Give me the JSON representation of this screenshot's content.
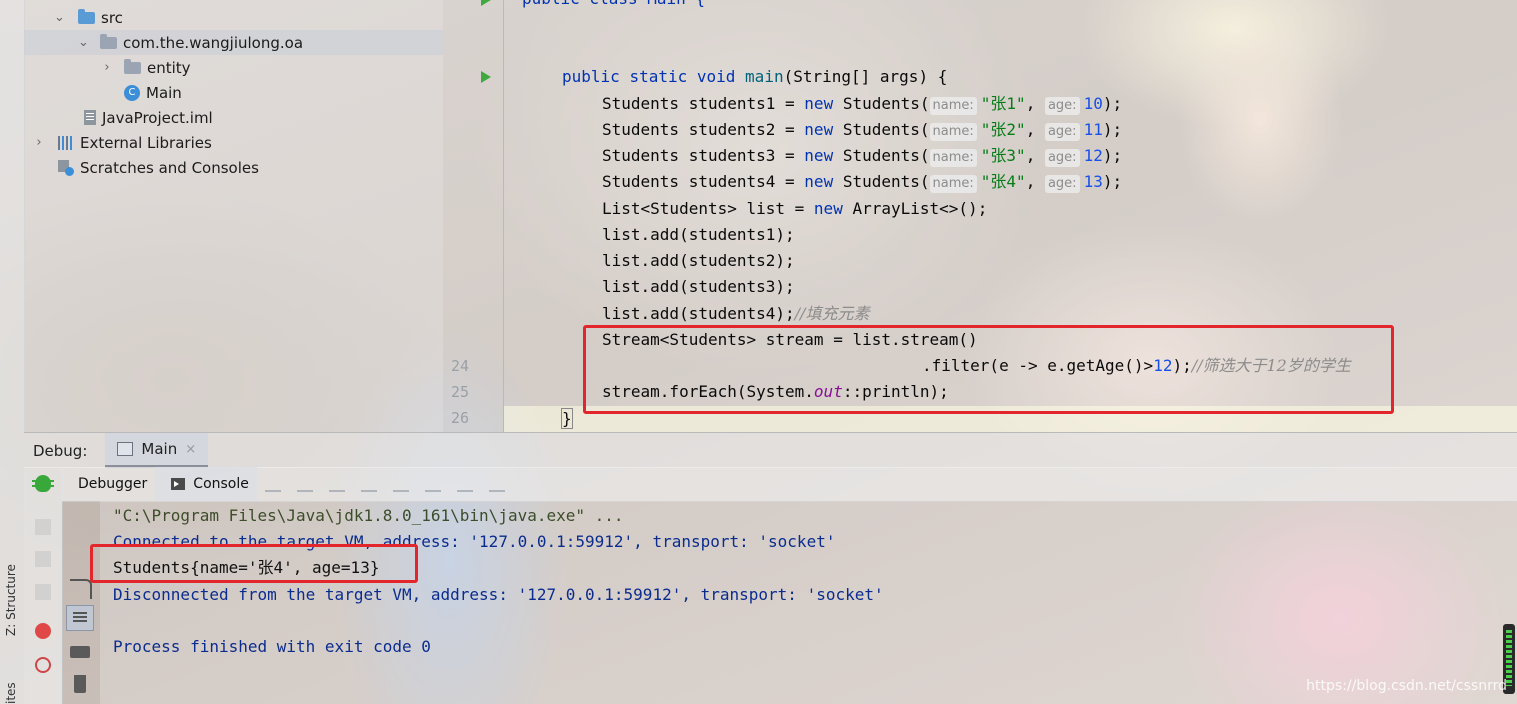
{
  "project_tree": {
    "items": [
      {
        "label": "src",
        "icon": "folder-icon"
      },
      {
        "label": "com.the.wangjiulong.oa",
        "icon": "package-icon"
      },
      {
        "label": "entity",
        "icon": "package-icon"
      },
      {
        "label": "Main",
        "icon": "class-icon"
      },
      {
        "label": "JavaProject.iml",
        "icon": "module-file-icon"
      },
      {
        "label": "External Libraries",
        "icon": "libraries-icon"
      },
      {
        "label": "Scratches and Consoles",
        "icon": "scratches-icon"
      }
    ],
    "class_icon_letter": "C"
  },
  "editor": {
    "line_numbers": [
      "24",
      "25",
      "26"
    ],
    "partial_top": "public class Main {",
    "method_signature": {
      "kw1": "public",
      "kw2": "static",
      "kw3": "void",
      "name": "main",
      "params": "(String[] args) {"
    },
    "hint_name": "name:",
    "hint_age": "age:",
    "declarations": [
      {
        "var": "Students students1 = ",
        "kw": "new",
        "cls": " Students(",
        "name_val": "\"张1\"",
        "age_val": "10",
        "end": ");"
      },
      {
        "var": "Students students2 = ",
        "kw": "new",
        "cls": " Students(",
        "name_val": "\"张2\"",
        "age_val": "11",
        "end": ");"
      },
      {
        "var": "Students students3 = ",
        "kw": "new",
        "cls": " Students(",
        "name_val": "\"张3\"",
        "age_val": "12",
        "end": ");"
      },
      {
        "var": "Students students4 = ",
        "kw": "new",
        "cls": " Students(",
        "name_val": "\"张4\"",
        "age_val": "13",
        "end": ");"
      }
    ],
    "list_decl": {
      "pre": "List<Students> list = ",
      "kw": "new",
      "post": " ArrayList<>();"
    },
    "adds": [
      "list.add(students1);",
      "list.add(students2);",
      "list.add(students3);",
      "list.add(students4);"
    ],
    "add_comment": "//填充元素",
    "stream_line": "Stream<Students> stream = list.stream()",
    "filter_line": {
      "pre": ".filter(e -> e.getAge()>",
      "num": "12",
      "post": ");",
      "comment": "//筛选大于12岁的学生"
    },
    "foreach_line": {
      "pre": "stream.forEach(System.",
      "field": "out",
      "post": "::println);"
    },
    "closing_brace": "}"
  },
  "debug": {
    "label": "Debug:",
    "session_tab": "Main",
    "close_glyph": "×",
    "tabs": [
      "Debugger",
      "Console"
    ],
    "side_labels": [
      "Z: Structure",
      "ites"
    ]
  },
  "console": {
    "lines": [
      {
        "text": "\"C:\\Program Files\\Java\\jdk1.8.0_161\\bin\\java.exe\" ...",
        "kind": "cmd"
      },
      {
        "text": "Connected to the target VM, address: '127.0.0.1:59912', transport: 'socket'",
        "kind": "info"
      },
      {
        "text": "Students{name='张4', age=13}",
        "kind": "out"
      },
      {
        "text": "Disconnected from the target VM, address: '127.0.0.1:59912', transport: 'socket'",
        "kind": "info"
      },
      {
        "text": "",
        "kind": "blank"
      },
      {
        "text": "Process finished with exit code 0",
        "kind": "info"
      }
    ]
  },
  "watermark": "https://blog.csdn.net/cssnrrd",
  "colors": {
    "keyword": "#0033b3",
    "string": "#067d17",
    "number": "#1750eb",
    "comment": "#8c8c8c",
    "highlight_box": "#e3262b",
    "console_info": "#0b2c8f"
  }
}
